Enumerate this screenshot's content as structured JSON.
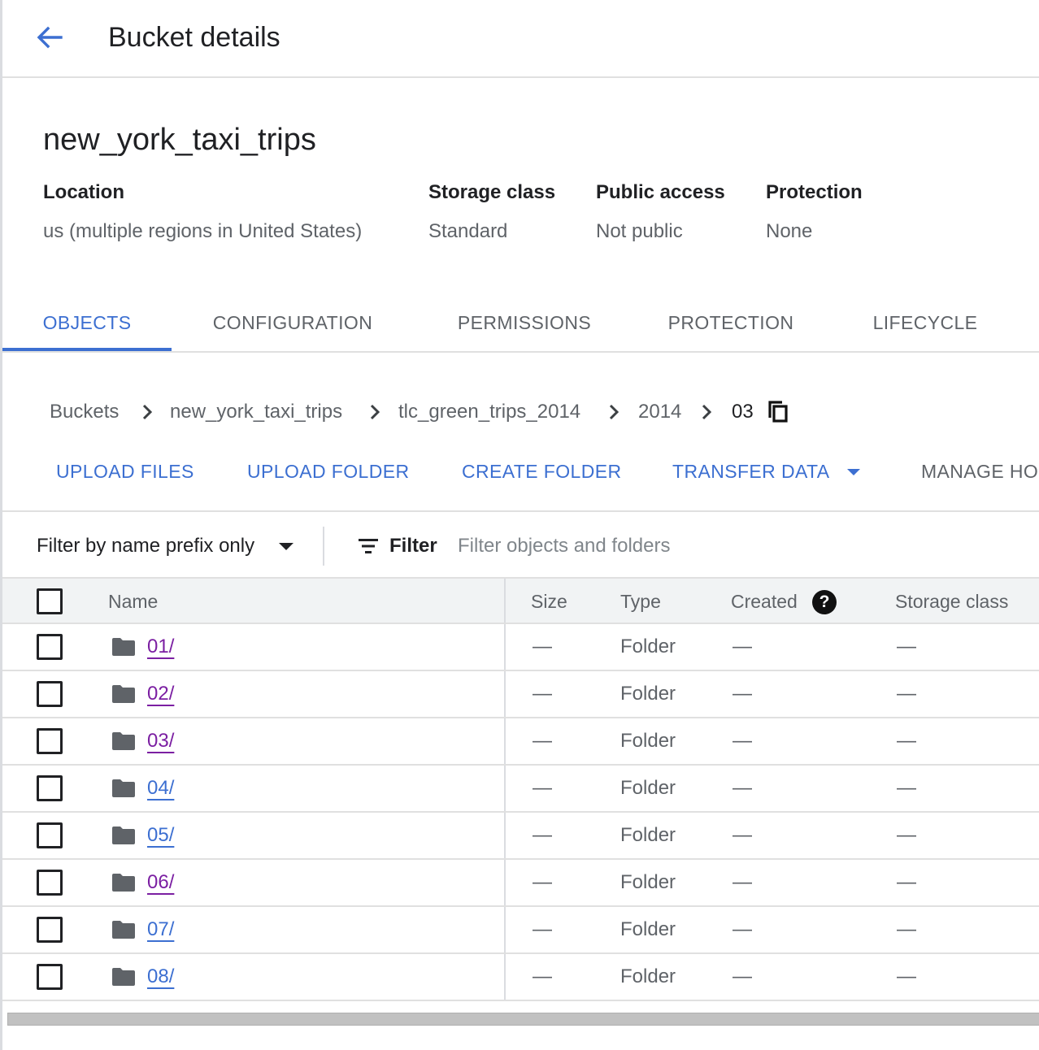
{
  "header": {
    "title": "Bucket details",
    "back_icon": "arrow-back-icon"
  },
  "bucket": {
    "name": "new_york_taxi_trips",
    "details": [
      {
        "label": "Location",
        "value": "us (multiple regions in United States)"
      },
      {
        "label": "Storage class",
        "value": "Standard"
      },
      {
        "label": "Public access",
        "value": "Not public"
      },
      {
        "label": "Protection",
        "value": "None"
      }
    ]
  },
  "tabs": [
    {
      "label": "OBJECTS",
      "active": true
    },
    {
      "label": "CONFIGURATION",
      "active": false
    },
    {
      "label": "PERMISSIONS",
      "active": false
    },
    {
      "label": "PROTECTION",
      "active": false
    },
    {
      "label": "LIFECYCLE",
      "active": false
    }
  ],
  "breadcrumb": [
    "Buckets",
    "new_york_taxi_trips",
    "tlc_green_trips_2014",
    "2014",
    "03"
  ],
  "actions": {
    "upload_files": "UPLOAD FILES",
    "upload_folder": "UPLOAD FOLDER",
    "create_folder": "CREATE FOLDER",
    "transfer_data": "TRANSFER DATA",
    "manage_holds": "MANAGE HO"
  },
  "filter": {
    "mode": "Filter by name prefix only",
    "label": "Filter",
    "placeholder": "Filter objects and folders"
  },
  "table": {
    "columns": [
      "Name",
      "Size",
      "Type",
      "Created",
      "Storage class"
    ],
    "rows": [
      {
        "name": "01/",
        "size": "—",
        "type": "Folder",
        "created": "—",
        "storage_class": "—",
        "visited": true
      },
      {
        "name": "02/",
        "size": "—",
        "type": "Folder",
        "created": "—",
        "storage_class": "—",
        "visited": true
      },
      {
        "name": "03/",
        "size": "—",
        "type": "Folder",
        "created": "—",
        "storage_class": "—",
        "visited": true
      },
      {
        "name": "04/",
        "size": "—",
        "type": "Folder",
        "created": "—",
        "storage_class": "—",
        "visited": false
      },
      {
        "name": "05/",
        "size": "—",
        "type": "Folder",
        "created": "—",
        "storage_class": "—",
        "visited": false
      },
      {
        "name": "06/",
        "size": "—",
        "type": "Folder",
        "created": "—",
        "storage_class": "—",
        "visited": true
      },
      {
        "name": "07/",
        "size": "—",
        "type": "Folder",
        "created": "—",
        "storage_class": "—",
        "visited": false
      },
      {
        "name": "08/",
        "size": "—",
        "type": "Folder",
        "created": "—",
        "storage_class": "—",
        "visited": false
      }
    ]
  },
  "colors": {
    "accent": "#3c6fd1",
    "visited_link": "#7b1fa2",
    "header_bg": "#f1f3f4",
    "divider": "#e0e0e0"
  }
}
